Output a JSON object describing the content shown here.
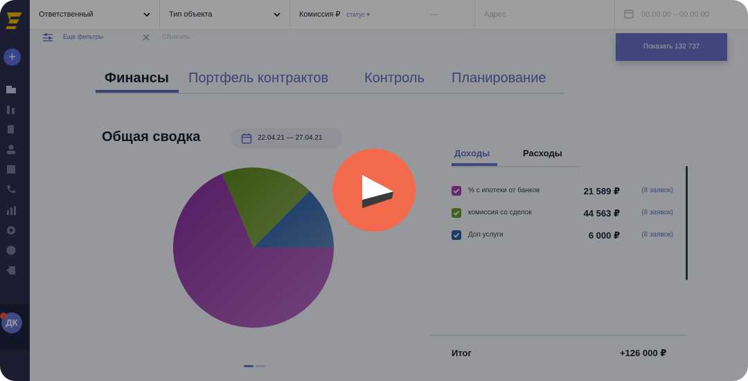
{
  "filters": {
    "responsible": "Ответственный",
    "object_type": "Тип объекта",
    "commission": "Комиссия ₽",
    "status_link": "статус ▾",
    "commission_dash": "—",
    "address_placeholder": "Адрес",
    "date_range": "00.00.00 – 00.00.00",
    "more_filters": "Еще фильтры",
    "reset": "Сбросить",
    "show_button": "Показать 132 737"
  },
  "tabs": [
    "Финансы",
    "Портфель контрактов",
    "Контроль",
    "Планирование"
  ],
  "summary": {
    "title": "Общая сводка",
    "date_range": "22.04.21 — 27.04.21"
  },
  "panel": {
    "tabs": [
      "Доходы",
      "Расходы"
    ],
    "rows": [
      {
        "label": "% с ипотеки от банков",
        "amount": "21 589 ₽",
        "count": "(8 заявок)",
        "color": "#a43fb2"
      },
      {
        "label": "комиссия со сделок",
        "amount": "44 563 ₽",
        "count": "(8 заявок)",
        "color": "#6f9a2a"
      },
      {
        "label": "Доп услуги",
        "amount": "6 000 ₽",
        "count": "(8 заявок)",
        "color": "#2c5fa8"
      }
    ],
    "total_label": "Итог",
    "total_value": "+126 000 ₽"
  },
  "user": {
    "initials": "ДК"
  },
  "colors": {
    "accent": "#5e6bc1",
    "play": "#f26a4b",
    "sidebar": "#2c3150"
  },
  "icons": [
    "logo-icon",
    "plus-icon",
    "building-icon",
    "chart-icon",
    "document-icon",
    "user-icon",
    "list-icon",
    "phone-icon",
    "bar-chart-icon",
    "gear-icon",
    "help-icon",
    "logout-icon",
    "calendar-icon",
    "filter-sliders-icon",
    "close-icon",
    "play-icon"
  ]
}
